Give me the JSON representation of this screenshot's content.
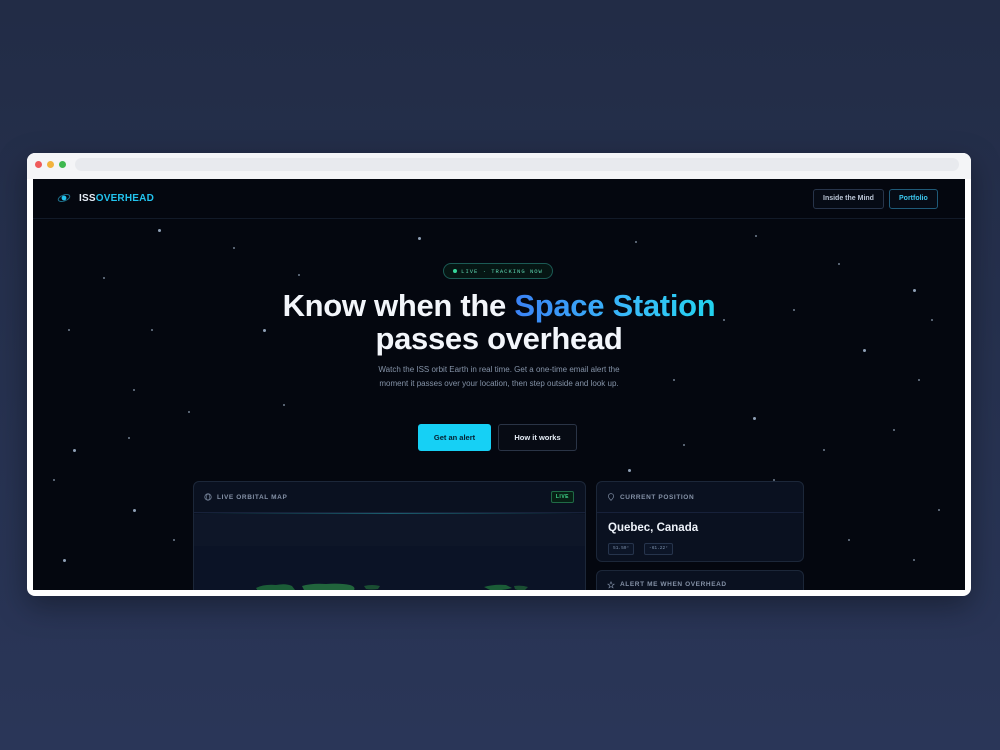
{
  "brand": {
    "prefix": "ISS",
    "suffix": "OVERHEAD"
  },
  "nav": {
    "inside_label": "Inside the Mind",
    "portfolio_label": "Portfolio"
  },
  "status_pill": "LIVE · TRACKING NOW",
  "hero": {
    "title_line1_pre": "Know when the ",
    "title_accent": "Space Station",
    "title_line2": "passes overhead",
    "subtitle": "Watch the ISS orbit Earth in real time. Get a one-time email alert the moment it passes over your location, then step outside and look up."
  },
  "cta": {
    "primary": "Get an alert",
    "secondary": "How it works"
  },
  "map_panel": {
    "label": "LIVE ORBITAL MAP",
    "badge": "LIVE"
  },
  "position_panel": {
    "label": "CURRENT POSITION",
    "place": "Quebec, Canada",
    "lat": "51.59°",
    "lon": "-61.22°"
  },
  "alert_panel": {
    "label": "ALERT ME WHEN OVERHEAD"
  },
  "colors": {
    "accent": "#16d0f5",
    "background": "#04070f",
    "live_green": "#3fd68a"
  },
  "icons": [
    "orbit-logo-icon",
    "globe-icon",
    "pin-icon",
    "star-icon",
    "status-dot-icon"
  ]
}
